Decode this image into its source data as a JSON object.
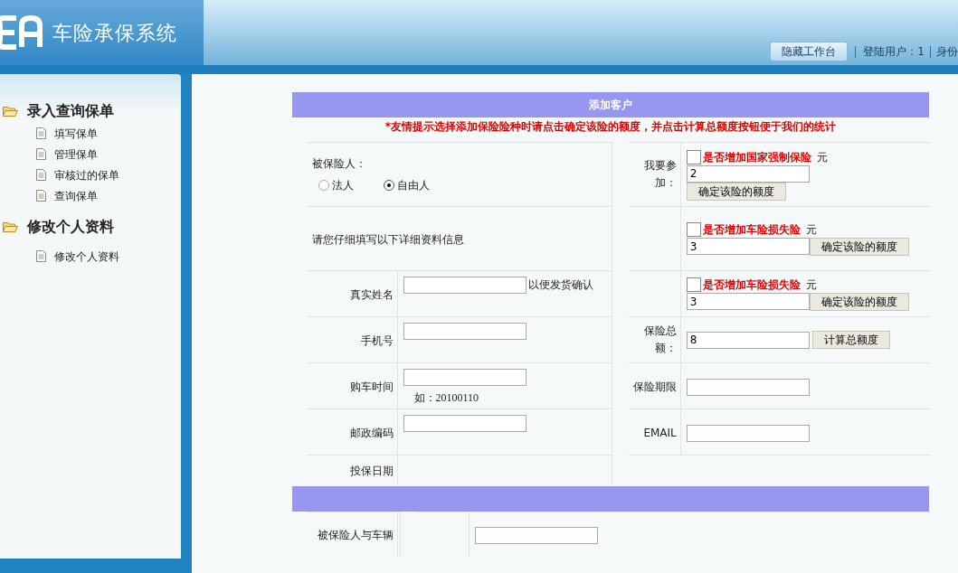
{
  "header": {
    "title": "车险承保系统",
    "hide_button": "隐藏工作台",
    "user_info": "登陆用户：1",
    "identity": "身份"
  },
  "sidebar": {
    "groups": [
      {
        "title": "录入查询保单",
        "items": [
          "填写保单",
          "管理保单",
          "审核过的保单",
          "查询保单"
        ]
      },
      {
        "title": "修改个人资料",
        "items": [
          "修改个人资料"
        ]
      }
    ]
  },
  "form": {
    "title": "添加客户",
    "hint": "*友情提示选择添加保险险种时请点击确定该险的额度，并点击计算总额度按钮便于我们的统计",
    "rows": [
      {
        "left": {
          "kind": "radio",
          "label": "被保险人：",
          "options": [
            {
              "label": "法人",
              "selected": false
            },
            {
              "label": "自由人",
              "selected": true
            }
          ]
        },
        "right": {
          "kind": "insurance",
          "label": "我要参加：",
          "checked": false,
          "name": "是否增加国家强制保险",
          "unit": "元",
          "value": "2",
          "button": "确定该险的额度"
        }
      },
      {
        "left": {
          "kind": "note",
          "text": "请您仔细填写以下详细资料信息"
        },
        "right": {
          "kind": "insurance",
          "checked": false,
          "name": "是否增加车险损失险",
          "unit": "元",
          "value": "3",
          "button": "确定该险的额度"
        }
      },
      {
        "left": {
          "kind": "field",
          "label": "真实姓名",
          "after": "以便发货确认"
        },
        "right": {
          "kind": "insurance",
          "checked": false,
          "name": "是否增加车险损失险",
          "unit": "元",
          "value": "3",
          "button": "确定该险的额度"
        }
      },
      {
        "left": {
          "kind": "field",
          "label": "手机号"
        },
        "right": {
          "kind": "total",
          "label": "保险总额：",
          "value": "8",
          "button": "计算总额度"
        }
      },
      {
        "left": {
          "kind": "field",
          "label": "购车时间",
          "example": "如：20100110"
        },
        "right": {
          "kind": "field",
          "label": "保险期限"
        }
      },
      {
        "left": {
          "kind": "field",
          "label": "邮政编码"
        },
        "right": {
          "kind": "field",
          "label": "EMAIL"
        }
      },
      {
        "left": {
          "kind": "label",
          "label": "投保日期"
        },
        "right": {
          "kind": "empty"
        }
      }
    ],
    "rows2": [
      {
        "left": {
          "kind": "label",
          "label": "被保险人与车辆"
        },
        "right": {
          "kind": "field"
        }
      }
    ]
  }
}
